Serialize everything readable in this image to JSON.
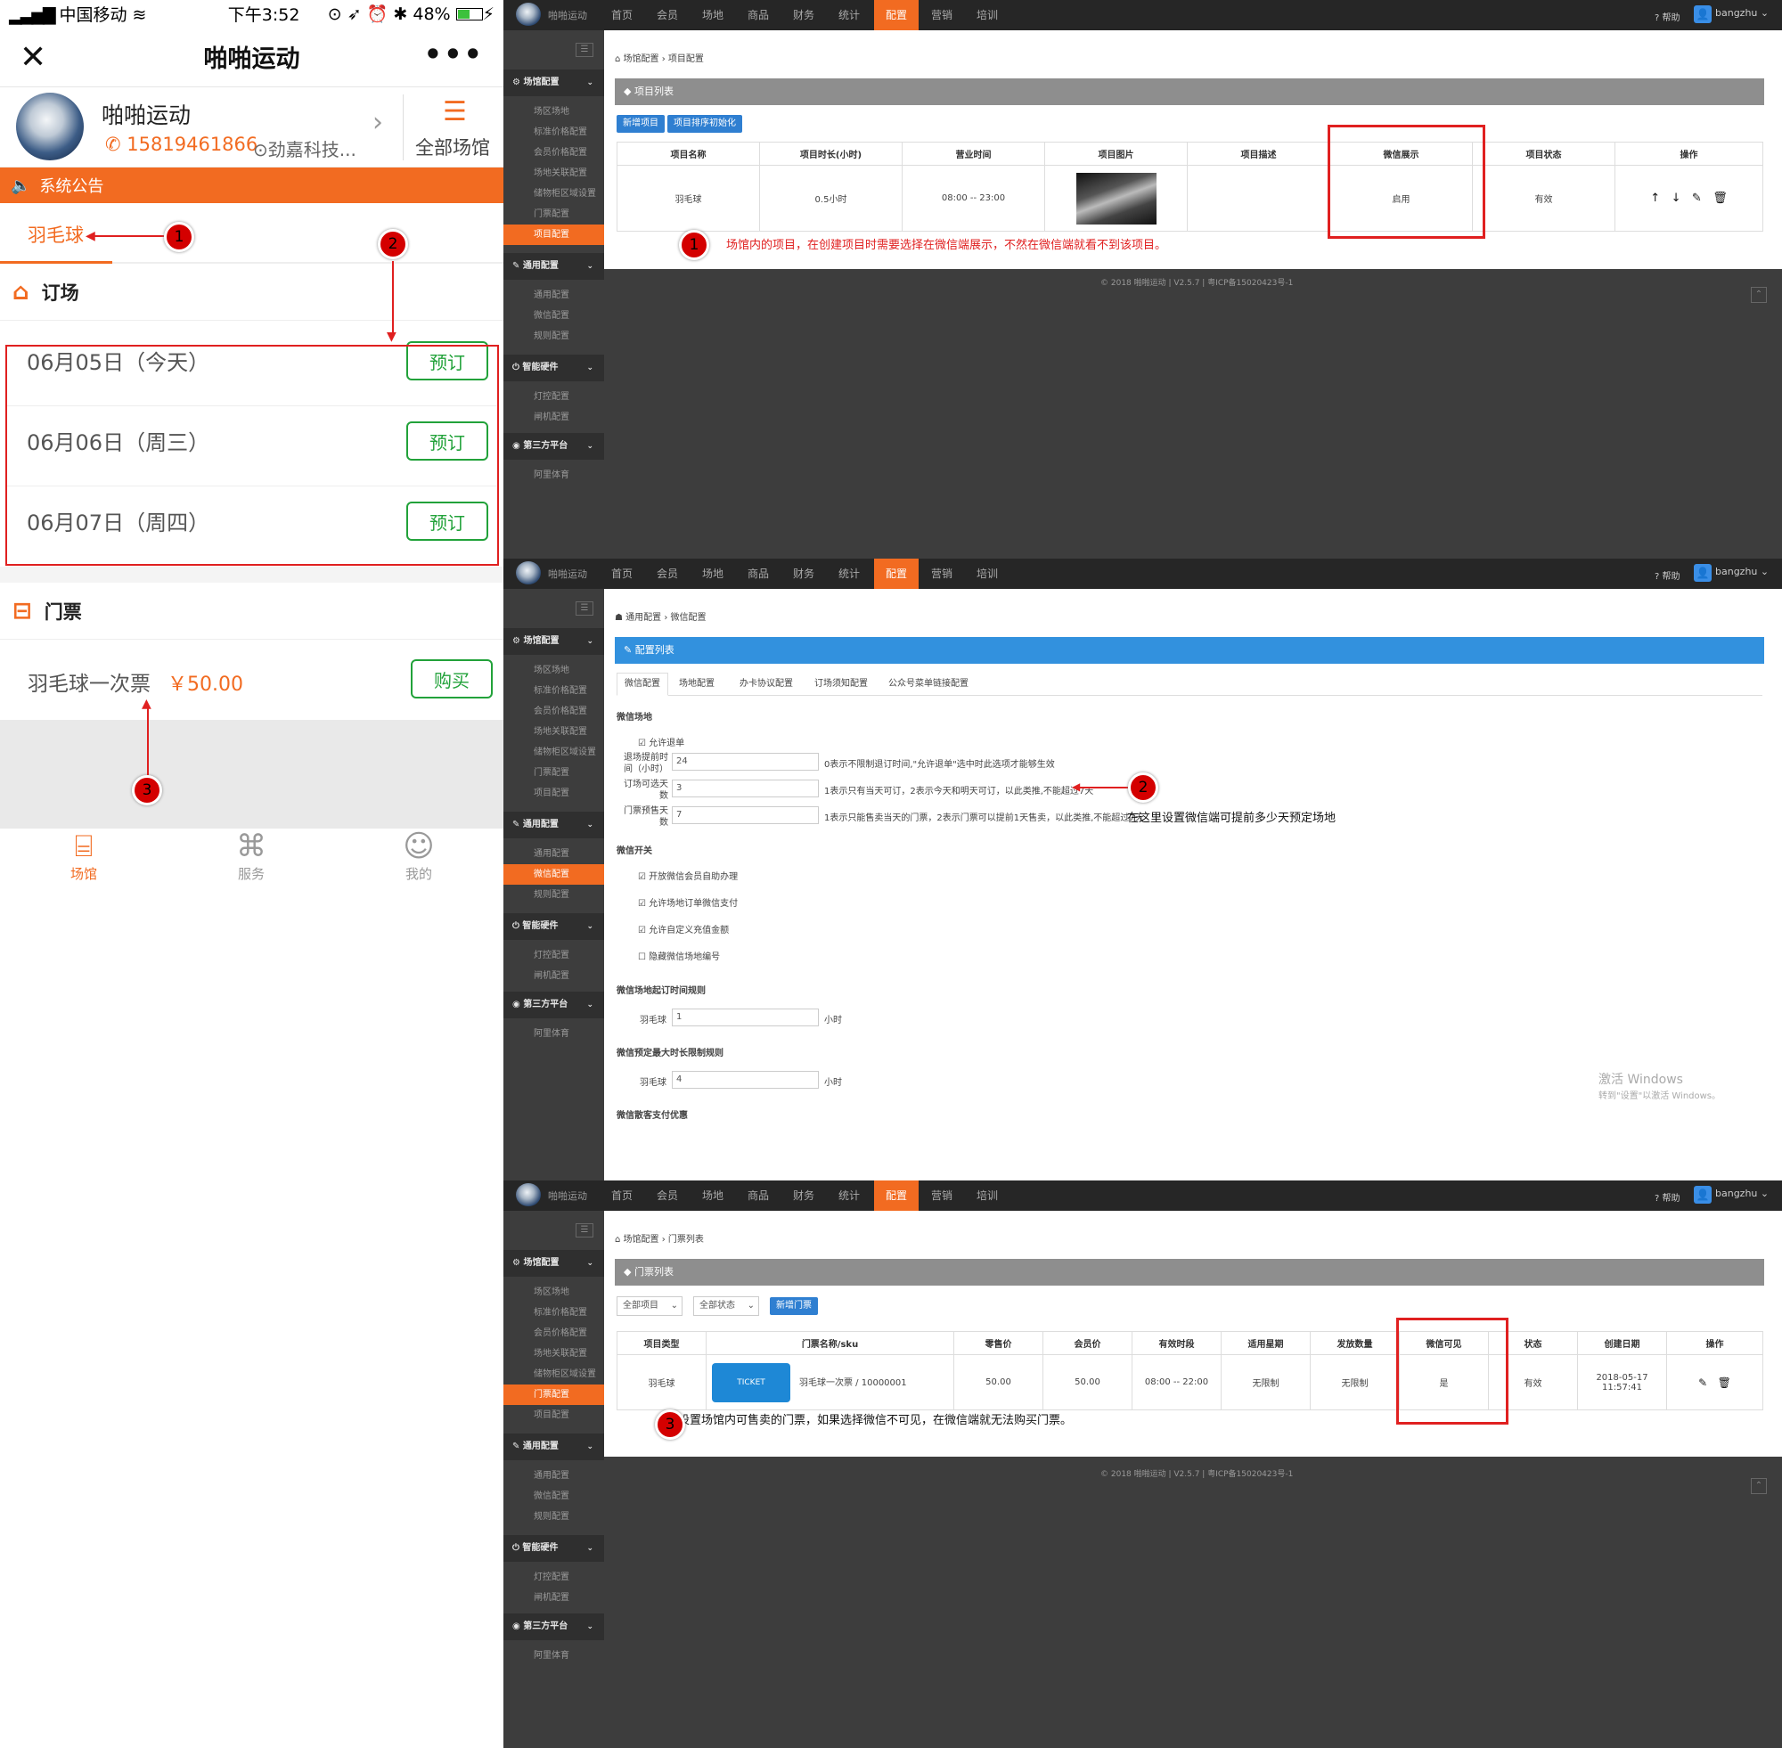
{
  "phone": {
    "status": {
      "carrier": "中国移动",
      "time": "下午3:52",
      "battery": "48%"
    },
    "nav": {
      "title": "啪啪运动",
      "close_icon": "✕",
      "more_icon": "•••"
    },
    "venue": {
      "name": "啪啪运动",
      "phone": "15819461866",
      "address": "劲嘉科技...",
      "all_label": "全部场馆"
    },
    "notice": "系统公告",
    "sport_tab": "羽毛球",
    "booking": {
      "title": "订场",
      "dates": [
        {
          "label": "06月05日（今天）",
          "button": "预订"
        },
        {
          "label": "06月06日（周三）",
          "button": "预订"
        },
        {
          "label": "06月07日（周四）",
          "button": "预订"
        }
      ]
    },
    "tickets": {
      "title": "门票",
      "item": "羽毛球一次票",
      "price": "￥50.00",
      "button": "购买"
    },
    "tabbar": [
      {
        "label": "场馆",
        "icon": "venue-icon",
        "active": true
      },
      {
        "label": "服务",
        "icon": "service-icon",
        "active": false
      },
      {
        "label": "我的",
        "icon": "user-icon",
        "active": false
      }
    ],
    "annotations": [
      "1",
      "2",
      "3"
    ]
  },
  "admin": {
    "logo_text": "啪啪运动",
    "nav": [
      "首页",
      "会员",
      "场地",
      "商品",
      "财务",
      "统计",
      "配置",
      "营销",
      "培训"
    ],
    "active_nav": "配置",
    "help": "帮助",
    "user": "bangzhu",
    "sidebar": {
      "groups": [
        {
          "label": "场馆配置",
          "items": [
            "场区场地",
            "标准价格配置",
            "会员价格配置",
            "场地关联配置",
            "储物柜区域设置",
            "门票配置",
            "项目配置"
          ]
        },
        {
          "label": "通用配置",
          "items": [
            "通用配置",
            "微信配置",
            "规则配置"
          ]
        },
        {
          "label": "智能硬件",
          "items": [
            "灯控配置",
            "闸机配置"
          ]
        },
        {
          "label": "第三方平台",
          "items": [
            "阿里体育"
          ]
        }
      ]
    },
    "footer": "© 2018 啪啪运动 | V2.5.7 | 粤ICP备15020423号-1"
  },
  "panel1": {
    "breadcrumb": "场馆配置 › 项目配置",
    "box_title": "项目列表",
    "buttons": [
      "新增项目",
      "项目排序初始化"
    ],
    "columns": [
      "项目名称",
      "项目时长(小时)",
      "营业时间",
      "项目图片",
      "项目描述",
      "微信展示",
      "项目状态",
      "操作"
    ],
    "row": {
      "name": "羽毛球",
      "duration": "0.5小时",
      "hours": "08:00 -- 23:00",
      "desc": "",
      "wechat": "启用",
      "status": "有效"
    },
    "annotation": "场馆内的项目，在创建项目时需要选择在微信端展示，不然在微信端就看不到该项目。"
  },
  "panel2": {
    "breadcrumb": "通用配置 › 微信配置",
    "box_title": "配置列表",
    "tabs": [
      "微信配置",
      "场地配置",
      "办卡协议配置",
      "订场须知配置",
      "公众号菜单链接配置"
    ],
    "section1": "微信场地",
    "allow_refund": "允许退单",
    "fields": [
      {
        "label": "退场提前时间（小时）",
        "value": "24",
        "hint": "0表示不限制退订时间,\"允许退单\"选中时此选项才能够生效"
      },
      {
        "label": "订场可选天数",
        "value": "3",
        "hint": "1表示只有当天可订，2表示今天和明天可订，以此类推,不能超过7天"
      },
      {
        "label": "门票预售天数",
        "value": "7",
        "hint": "1表示只能售卖当天的门票，2表示门票可以提前1天售卖，以此类推,不能超过7天"
      }
    ],
    "annotation": "在这里设置微信端可提前多少天预定场地",
    "section2": "微信开关",
    "switches": [
      {
        "label": "开放微信会员自助办理",
        "checked": true
      },
      {
        "label": "允许场地订单微信支付",
        "checked": true
      },
      {
        "label": "允许自定义充值金额",
        "checked": true
      },
      {
        "label": "隐藏微信场地编号",
        "checked": false
      }
    ],
    "section3": "微信场地起订时间规则",
    "rule1": {
      "label": "羽毛球",
      "value": "1",
      "unit": "小时"
    },
    "section4": "微信预定最大时长限制规则",
    "rule2": {
      "label": "羽毛球",
      "value": "4",
      "unit": "小时"
    },
    "section5": "微信散客支付优惠",
    "watermark1": "激活 Windows",
    "watermark2": "转到\"设置\"以激活 Windows。"
  },
  "panel3": {
    "breadcrumb": "场馆配置 › 门票列表",
    "box_title": "门票列表",
    "filters": [
      "全部项目",
      "全部状态"
    ],
    "button": "新增门票",
    "columns": [
      "项目类型",
      "门票名称/sku",
      "零售价",
      "会员价",
      "有效时段",
      "适用星期",
      "发放数量",
      "微信可见",
      "状态",
      "创建日期",
      "操作"
    ],
    "row": {
      "type": "羽毛球",
      "ticket_image_text": "TICKET",
      "name": "羽毛球一次票 / 10000001",
      "retail": "50.00",
      "member": "50.00",
      "period": "08:00 -- 22:00",
      "weekday": "无限制",
      "quantity": "无限制",
      "visible": "是",
      "status": "有效",
      "date": "2018-05-17",
      "time": "11:57:41"
    },
    "annotation": "设置场馆内可售卖的门票，如果选择微信不可见，在微信端就无法购买门票。"
  },
  "colors": {
    "orange": "#f26b21",
    "green": "#22a23a",
    "red": "#e02020",
    "dark": "#3d3d3d",
    "blue": "#2f7fd1"
  }
}
